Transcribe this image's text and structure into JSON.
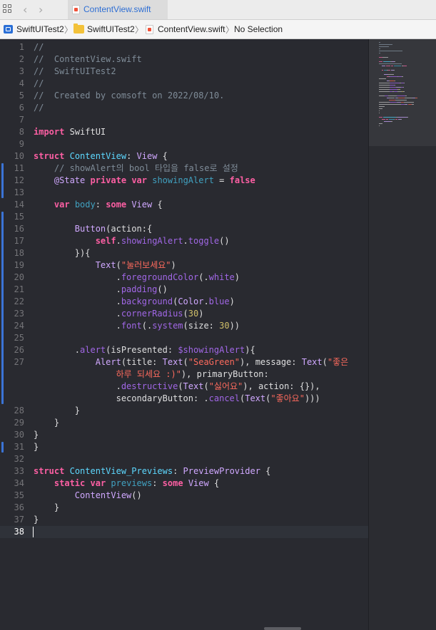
{
  "tab": {
    "label": "ContentView.swift",
    "nav_back": "‹",
    "nav_forward": "›"
  },
  "jumpbar": {
    "project": "SwiftUITest2",
    "group": "SwiftUITest2",
    "file": "ContentView.swift",
    "selection": "No Selection",
    "separator": "〉"
  },
  "colors": {
    "accent": "#2f6fd4",
    "editor_bg": "#292a30",
    "change_bar": "#3b74d6",
    "keyword": "#fc5fa3",
    "string": "#fc6a5d",
    "comment": "#7f8c98",
    "type": "#5dd8ff"
  },
  "editor": {
    "current_line": 38,
    "change_bars": [
      [
        11,
        13
      ],
      [
        15,
        27
      ],
      [
        31,
        31
      ]
    ],
    "lines": [
      {
        "num": "1",
        "tokens": [
          {
            "t": "//",
            "c": "com"
          }
        ]
      },
      {
        "num": "2",
        "tokens": [
          {
            "t": "//  ContentView.swift",
            "c": "com"
          }
        ]
      },
      {
        "num": "3",
        "tokens": [
          {
            "t": "//  SwiftUITest2",
            "c": "com"
          }
        ]
      },
      {
        "num": "4",
        "tokens": [
          {
            "t": "//",
            "c": "com"
          }
        ]
      },
      {
        "num": "5",
        "tokens": [
          {
            "t": "//  Created by comsoft on 2022/08/10.",
            "c": "com"
          }
        ]
      },
      {
        "num": "6",
        "tokens": [
          {
            "t": "//",
            "c": "com"
          }
        ]
      },
      {
        "num": "7",
        "tokens": []
      },
      {
        "num": "8",
        "tokens": [
          {
            "t": "import",
            "c": "kw"
          },
          {
            "t": " SwiftUI",
            "c": "plain"
          }
        ]
      },
      {
        "num": "9",
        "tokens": []
      },
      {
        "num": "10",
        "tokens": [
          {
            "t": "struct",
            "c": "kw"
          },
          {
            "t": " ",
            "c": "plain"
          },
          {
            "t": "ContentView",
            "c": "type"
          },
          {
            "t": ": ",
            "c": "plain"
          },
          {
            "t": "View",
            "c": "ptype"
          },
          {
            "t": " {",
            "c": "plain"
          }
        ]
      },
      {
        "num": "11",
        "tokens": [
          {
            "t": "    // showAlert의 bool 타입을 false로 설정",
            "c": "com"
          }
        ]
      },
      {
        "num": "12",
        "tokens": [
          {
            "t": "    ",
            "c": "plain"
          },
          {
            "t": "@State",
            "c": "ptype"
          },
          {
            "t": " ",
            "c": "plain"
          },
          {
            "t": "private",
            "c": "kw"
          },
          {
            "t": " ",
            "c": "plain"
          },
          {
            "t": "var",
            "c": "kw"
          },
          {
            "t": " ",
            "c": "plain"
          },
          {
            "t": "showingAlert",
            "c": "var"
          },
          {
            "t": " = ",
            "c": "plain"
          },
          {
            "t": "false",
            "c": "kw"
          }
        ]
      },
      {
        "num": "13",
        "tokens": []
      },
      {
        "num": "14",
        "tokens": [
          {
            "t": "    ",
            "c": "plain"
          },
          {
            "t": "var",
            "c": "kw"
          },
          {
            "t": " ",
            "c": "plain"
          },
          {
            "t": "body",
            "c": "var"
          },
          {
            "t": ": ",
            "c": "plain"
          },
          {
            "t": "some",
            "c": "kw"
          },
          {
            "t": " ",
            "c": "plain"
          },
          {
            "t": "View",
            "c": "ptype"
          },
          {
            "t": " {",
            "c": "plain"
          }
        ]
      },
      {
        "num": "15",
        "tokens": []
      },
      {
        "num": "16",
        "tokens": [
          {
            "t": "        ",
            "c": "plain"
          },
          {
            "t": "Button",
            "c": "ptype"
          },
          {
            "t": "(action:{",
            "c": "plain"
          }
        ]
      },
      {
        "num": "17",
        "tokens": [
          {
            "t": "            ",
            "c": "plain"
          },
          {
            "t": "self",
            "c": "kw"
          },
          {
            "t": ".",
            "c": "plain"
          },
          {
            "t": "showingAlert",
            "c": "prop"
          },
          {
            "t": ".",
            "c": "plain"
          },
          {
            "t": "toggle",
            "c": "func"
          },
          {
            "t": "()",
            "c": "plain"
          }
        ]
      },
      {
        "num": "18",
        "tokens": [
          {
            "t": "        }){",
            "c": "plain"
          }
        ]
      },
      {
        "num": "19",
        "tokens": [
          {
            "t": "            ",
            "c": "plain"
          },
          {
            "t": "Text",
            "c": "ptype"
          },
          {
            "t": "(",
            "c": "plain"
          },
          {
            "t": "\"눌러보세요\"",
            "c": "str"
          },
          {
            "t": ")",
            "c": "plain"
          }
        ]
      },
      {
        "num": "20",
        "tokens": [
          {
            "t": "                .",
            "c": "plain"
          },
          {
            "t": "foregroundColor",
            "c": "func"
          },
          {
            "t": "(.",
            "c": "plain"
          },
          {
            "t": "white",
            "c": "prop"
          },
          {
            "t": ")",
            "c": "plain"
          }
        ]
      },
      {
        "num": "21",
        "tokens": [
          {
            "t": "                .",
            "c": "plain"
          },
          {
            "t": "padding",
            "c": "func"
          },
          {
            "t": "()",
            "c": "plain"
          }
        ]
      },
      {
        "num": "22",
        "tokens": [
          {
            "t": "                .",
            "c": "plain"
          },
          {
            "t": "background",
            "c": "func"
          },
          {
            "t": "(",
            "c": "plain"
          },
          {
            "t": "Color",
            "c": "ptype"
          },
          {
            "t": ".",
            "c": "plain"
          },
          {
            "t": "blue",
            "c": "prop"
          },
          {
            "t": ")",
            "c": "plain"
          }
        ]
      },
      {
        "num": "23",
        "tokens": [
          {
            "t": "                .",
            "c": "plain"
          },
          {
            "t": "cornerRadius",
            "c": "func"
          },
          {
            "t": "(",
            "c": "plain"
          },
          {
            "t": "30",
            "c": "num"
          },
          {
            "t": ")",
            "c": "plain"
          }
        ]
      },
      {
        "num": "24",
        "tokens": [
          {
            "t": "                .",
            "c": "plain"
          },
          {
            "t": "font",
            "c": "func"
          },
          {
            "t": "(.",
            "c": "plain"
          },
          {
            "t": "system",
            "c": "func"
          },
          {
            "t": "(size: ",
            "c": "plain"
          },
          {
            "t": "30",
            "c": "num"
          },
          {
            "t": "))",
            "c": "plain"
          }
        ]
      },
      {
        "num": "25",
        "tokens": []
      },
      {
        "num": "26",
        "tokens": [
          {
            "t": "        .",
            "c": "plain"
          },
          {
            "t": "alert",
            "c": "func"
          },
          {
            "t": "(isPresented: ",
            "c": "plain"
          },
          {
            "t": "$showingAlert",
            "c": "prop"
          },
          {
            "t": "){",
            "c": "plain"
          }
        ]
      },
      {
        "num": "27",
        "tokens": [
          {
            "t": "            ",
            "c": "plain"
          },
          {
            "t": "Alert",
            "c": "ptype"
          },
          {
            "t": "(title: ",
            "c": "plain"
          },
          {
            "t": "Text",
            "c": "ptype"
          },
          {
            "t": "(",
            "c": "plain"
          },
          {
            "t": "\"SeaGreen\"",
            "c": "str"
          },
          {
            "t": "), message: ",
            "c": "plain"
          },
          {
            "t": "Text",
            "c": "ptype"
          },
          {
            "t": "(",
            "c": "plain"
          },
          {
            "t": "\"좋은",
            "c": "str"
          }
        ]
      },
      {
        "num": "",
        "tokens": [
          {
            "t": "                ",
            "c": "plain"
          },
          {
            "t": "하루 되세요 :)\"",
            "c": "str"
          },
          {
            "t": "), primaryButton:",
            "c": "plain"
          }
        ]
      },
      {
        "num": "",
        "tokens": [
          {
            "t": "                .",
            "c": "plain"
          },
          {
            "t": "destructive",
            "c": "func"
          },
          {
            "t": "(",
            "c": "plain"
          },
          {
            "t": "Text",
            "c": "ptype"
          },
          {
            "t": "(",
            "c": "plain"
          },
          {
            "t": "\"싫어요\"",
            "c": "str"
          },
          {
            "t": "), action: {}),",
            "c": "plain"
          }
        ]
      },
      {
        "num": "",
        "tokens": [
          {
            "t": "                secondaryButton: .",
            "c": "plain"
          },
          {
            "t": "cancel",
            "c": "func"
          },
          {
            "t": "(",
            "c": "plain"
          },
          {
            "t": "Text",
            "c": "ptype"
          },
          {
            "t": "(",
            "c": "plain"
          },
          {
            "t": "\"좋아요\"",
            "c": "str"
          },
          {
            "t": ")))",
            "c": "plain"
          }
        ]
      },
      {
        "num": "28",
        "tokens": [
          {
            "t": "        }",
            "c": "plain"
          }
        ]
      },
      {
        "num": "29",
        "tokens": [
          {
            "t": "    }",
            "c": "plain"
          }
        ]
      },
      {
        "num": "30",
        "tokens": [
          {
            "t": "}",
            "c": "plain"
          }
        ]
      },
      {
        "num": "31",
        "tokens": [
          {
            "t": "}",
            "c": "plain"
          }
        ]
      },
      {
        "num": "32",
        "tokens": []
      },
      {
        "num": "33",
        "tokens": [
          {
            "t": "struct",
            "c": "kw"
          },
          {
            "t": " ",
            "c": "plain"
          },
          {
            "t": "ContentView_Previews",
            "c": "type"
          },
          {
            "t": ": ",
            "c": "plain"
          },
          {
            "t": "PreviewProvider",
            "c": "ptype"
          },
          {
            "t": " {",
            "c": "plain"
          }
        ]
      },
      {
        "num": "34",
        "tokens": [
          {
            "t": "    ",
            "c": "plain"
          },
          {
            "t": "static",
            "c": "kw"
          },
          {
            "t": " ",
            "c": "plain"
          },
          {
            "t": "var",
            "c": "kw"
          },
          {
            "t": " ",
            "c": "plain"
          },
          {
            "t": "previews",
            "c": "var"
          },
          {
            "t": ": ",
            "c": "plain"
          },
          {
            "t": "some",
            "c": "kw"
          },
          {
            "t": " ",
            "c": "plain"
          },
          {
            "t": "View",
            "c": "ptype"
          },
          {
            "t": " {",
            "c": "plain"
          }
        ]
      },
      {
        "num": "35",
        "tokens": [
          {
            "t": "        ",
            "c": "plain"
          },
          {
            "t": "ContentView",
            "c": "ptype"
          },
          {
            "t": "()",
            "c": "plain"
          }
        ]
      },
      {
        "num": "36",
        "tokens": [
          {
            "t": "    }",
            "c": "plain"
          }
        ]
      },
      {
        "num": "37",
        "tokens": [
          {
            "t": "}",
            "c": "plain"
          }
        ]
      },
      {
        "num": "38",
        "tokens": []
      }
    ]
  }
}
